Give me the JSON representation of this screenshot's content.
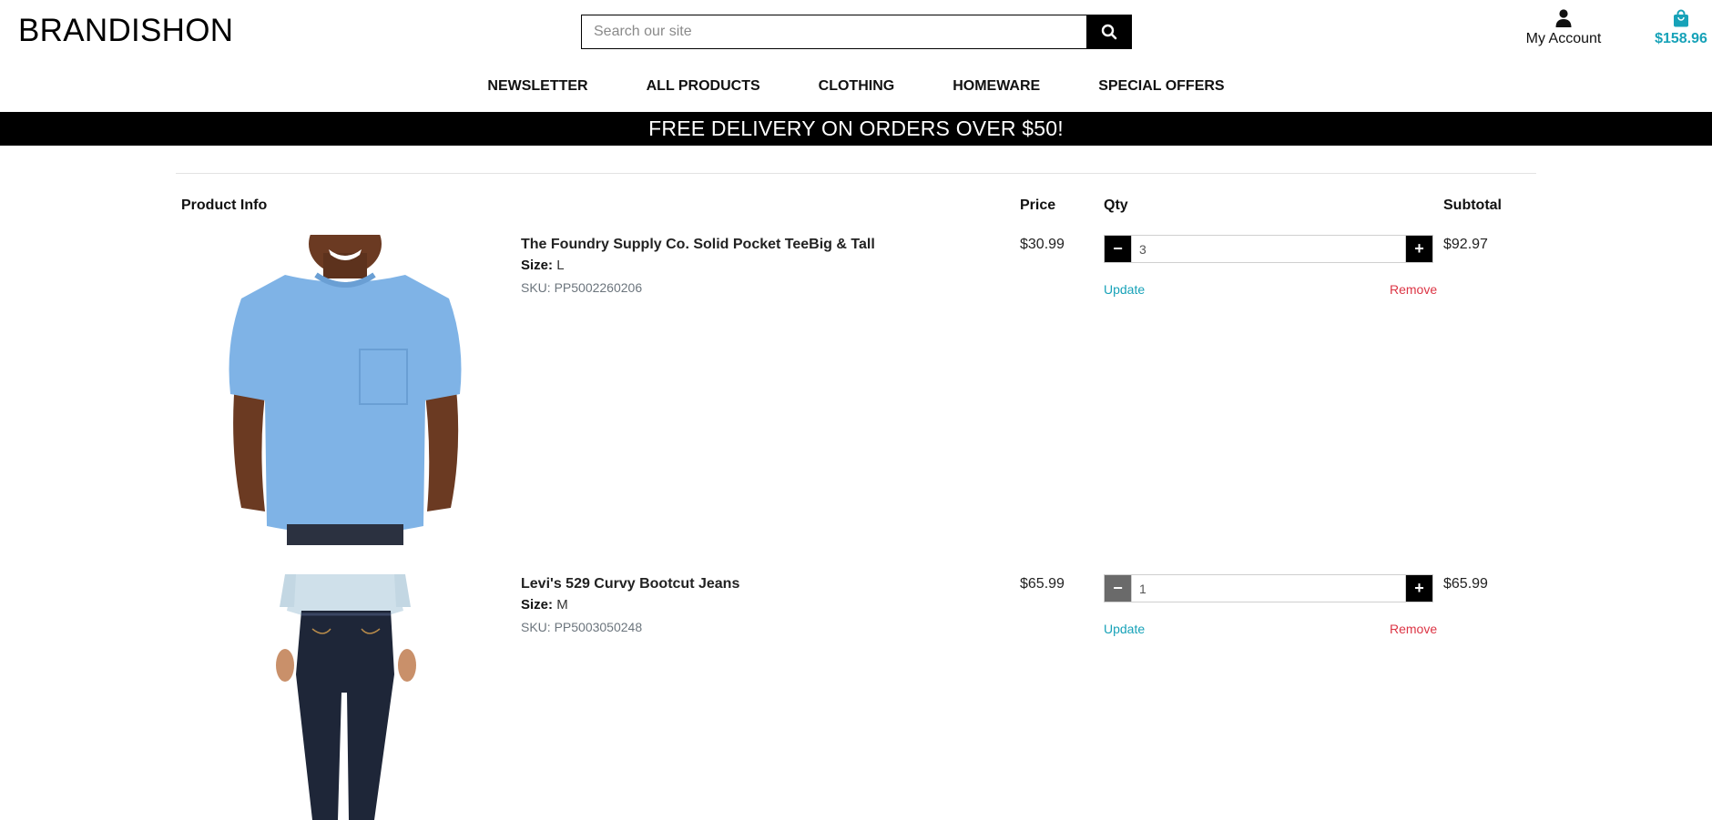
{
  "header": {
    "brand": "BRANDISHON",
    "search": {
      "placeholder": "Search our site",
      "value": ""
    },
    "account_label": "My Account",
    "bag_total": "$158.96"
  },
  "nav": [
    {
      "label": "NEWSLETTER"
    },
    {
      "label": "ALL PRODUCTS"
    },
    {
      "label": "CLOTHING"
    },
    {
      "label": "HOMEWARE"
    },
    {
      "label": "SPECIAL OFFERS"
    }
  ],
  "banner": "FREE DELIVERY ON ORDERS OVER $50!",
  "cart": {
    "headers": {
      "product_info": "Product Info",
      "price": "Price",
      "qty": "Qty",
      "subtotal": "Subtotal"
    },
    "items": [
      {
        "name": "The Foundry Supply Co. Solid Pocket TeeBig & Tall",
        "size_label": "Size:",
        "size": "L",
        "sku": "SKU: PP5002260206",
        "price": "$30.99",
        "qty": "3",
        "subtotal": "$92.97",
        "update_label": "Update",
        "remove_label": "Remove",
        "minus_symbol": "−",
        "plus_symbol": "+"
      },
      {
        "name": "Levi's 529 Curvy Bootcut Jeans",
        "size_label": "Size:",
        "size": "M",
        "sku": "SKU: PP5003050248",
        "price": "$65.99",
        "qty": "1",
        "subtotal": "$65.99",
        "update_label": "Update",
        "remove_label": "Remove",
        "minus_symbol": "−",
        "plus_symbol": "+"
      }
    ]
  },
  "colors": {
    "accent": "#17a2b8",
    "remove": "#dc3545",
    "banner_bg": "#000000",
    "tee_blue": "#7fb3e6"
  },
  "icons": {
    "search": "search-icon",
    "account": "user-icon",
    "bag": "shopping-bag-icon"
  }
}
